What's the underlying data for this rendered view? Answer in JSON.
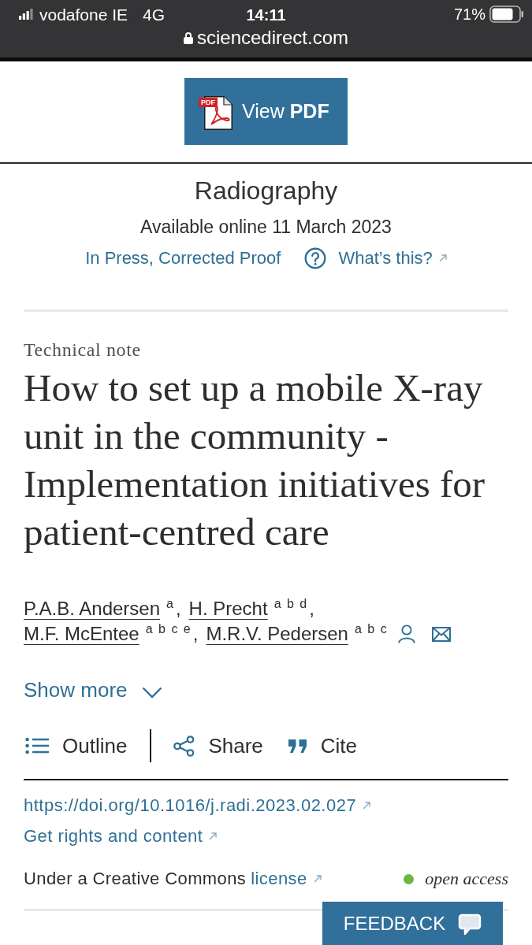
{
  "status_bar": {
    "carrier": "vodafone IE",
    "network": "4G",
    "time": "14:11",
    "battery": "71%",
    "url": "sciencedirect.com"
  },
  "pdf_button": {
    "icon_label": "PDF",
    "label": "View **PDF**"
  },
  "journal": {
    "name": "Radiography",
    "availability": "Available online 11 March 2023",
    "status_link": "In Press, Corrected Proof",
    "help_link": "What’s this?"
  },
  "article": {
    "type": "Technical note",
    "title": "How to set up a mobile X-ray unit in the community - Implementation initiatives for patient-centred care",
    "authors": [
      {
        "name": "P.A.B. Andersen",
        "affiliations": "a",
        "separator": ",",
        "corresponding": false
      },
      {
        "name": "H. Precht",
        "affiliations": "a b d",
        "separator": ",",
        "corresponding": false
      },
      {
        "name": "M.F. McEntee",
        "affiliations": "a b c e",
        "separator": ",",
        "corresponding": false
      },
      {
        "name": "M.R.V. Pedersen",
        "affiliations": "a b c",
        "corresponding": true
      }
    ],
    "show_more": "Show more"
  },
  "toolbar": [
    {
      "kind": "outline",
      "label": "Outline"
    },
    {
      "kind": "share",
      "label": "Share"
    },
    {
      "kind": "cite",
      "label": "Cite"
    }
  ],
  "links": {
    "doi": "https://doi.org/10.1016/j.radi.2023.02.027",
    "rights": "Get rights and content"
  },
  "license": {
    "text": "Under a Creative Commons",
    "link": "license",
    "access": "open access"
  },
  "feedback": {
    "label": "FEEDBACK"
  }
}
